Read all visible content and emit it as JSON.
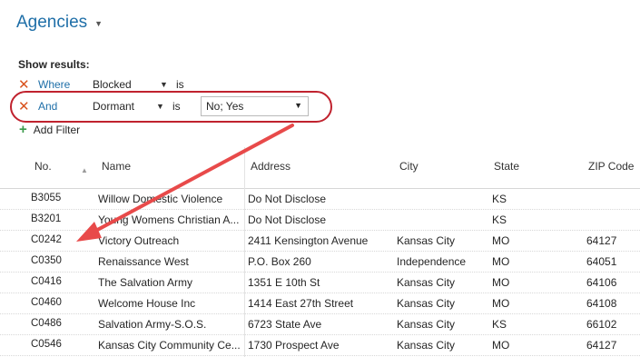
{
  "page": {
    "title": "Agencies"
  },
  "filters": {
    "heading": "Show results:",
    "rows": [
      {
        "conjunction": "Where",
        "field": "Blocked",
        "operator": "is",
        "value": ""
      },
      {
        "conjunction": "And",
        "field": "Dormant",
        "operator": "is",
        "value": "No; Yes"
      }
    ],
    "add_label": "Add Filter"
  },
  "table": {
    "columns": [
      "No.",
      "Name",
      "Address",
      "City",
      "State",
      "ZIP Code"
    ],
    "rows": [
      {
        "no": "B3055",
        "name": "Willow Domestic Violence",
        "address": "Do Not Disclose",
        "city": "",
        "state": "KS",
        "zip": ""
      },
      {
        "no": "B3201",
        "name": "Young Womens Christian A...",
        "address": "Do Not Disclose",
        "city": "",
        "state": "KS",
        "zip": ""
      },
      {
        "no": "C0242",
        "name": "Victory Outreach",
        "address": "2411 Kensington Avenue",
        "city": "Kansas City",
        "state": "MO",
        "zip": "64127"
      },
      {
        "no": "C0350",
        "name": "Renaissance West",
        "address": "P.O. Box 260",
        "city": "Independence",
        "state": "MO",
        "zip": "64051"
      },
      {
        "no": "C0416",
        "name": "The Salvation Army",
        "address": "1351 E 10th  St",
        "city": "Kansas City",
        "state": "MO",
        "zip": "64106"
      },
      {
        "no": "C0460",
        "name": "Welcome House  Inc",
        "address": "1414 East 27th Street",
        "city": "Kansas City",
        "state": "MO",
        "zip": "64108"
      },
      {
        "no": "C0486",
        "name": "Salvation Army-S.O.S.",
        "address": "6723 State Ave",
        "city": "Kansas City",
        "state": "KS",
        "zip": "66102"
      },
      {
        "no": "C0546",
        "name": "Kansas City Community Ce...",
        "address": "1730 Prospect Ave",
        "city": "Kansas City",
        "state": "MO",
        "zip": "64127"
      }
    ]
  },
  "icons": {
    "remove": "close-icon",
    "add": "plus-icon",
    "dropdown": "chevron-down-icon",
    "sort": "sort-ascending-icon"
  },
  "colors": {
    "accent": "#1f6fa8",
    "remove_icon": "#d9531e",
    "add_icon": "#3a9a4a",
    "annotation": "#c0222e",
    "arrow": "#e84a4a"
  }
}
